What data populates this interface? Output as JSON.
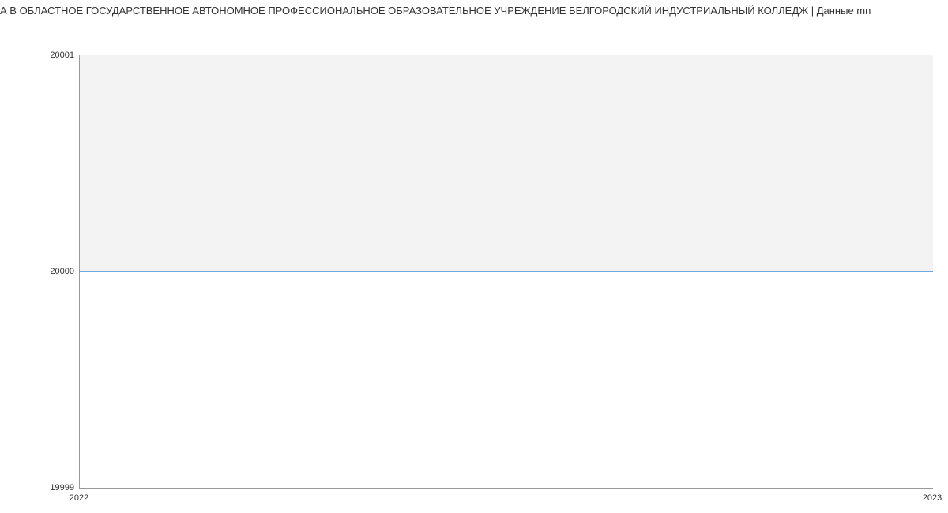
{
  "chart_data": {
    "type": "area",
    "title": "А В ОБЛАСТНОЕ ГОСУДАРСТВЕННОЕ АВТОНОМНОЕ ПРОФЕССИОНАЛЬНОЕ ОБРАЗОВАТЕЛЬНОЕ УЧРЕЖДЕНИЕ БЕЛГОРОДСКИЙ ИНДУСТРИАЛЬНЫЙ КОЛЛЕДЖ | Данные mn",
    "x": [
      2022,
      2023
    ],
    "values": [
      20000,
      20000
    ],
    "xlabel": "",
    "ylabel": "",
    "xlim": [
      2022,
      2023
    ],
    "ylim": [
      19999,
      20001
    ],
    "x_ticks": [
      "2022",
      "2023"
    ],
    "y_ticks": [
      "19999",
      "20000",
      "20001"
    ],
    "line_color": "#6FA8DC",
    "fill_color": "#F3F3F3"
  }
}
